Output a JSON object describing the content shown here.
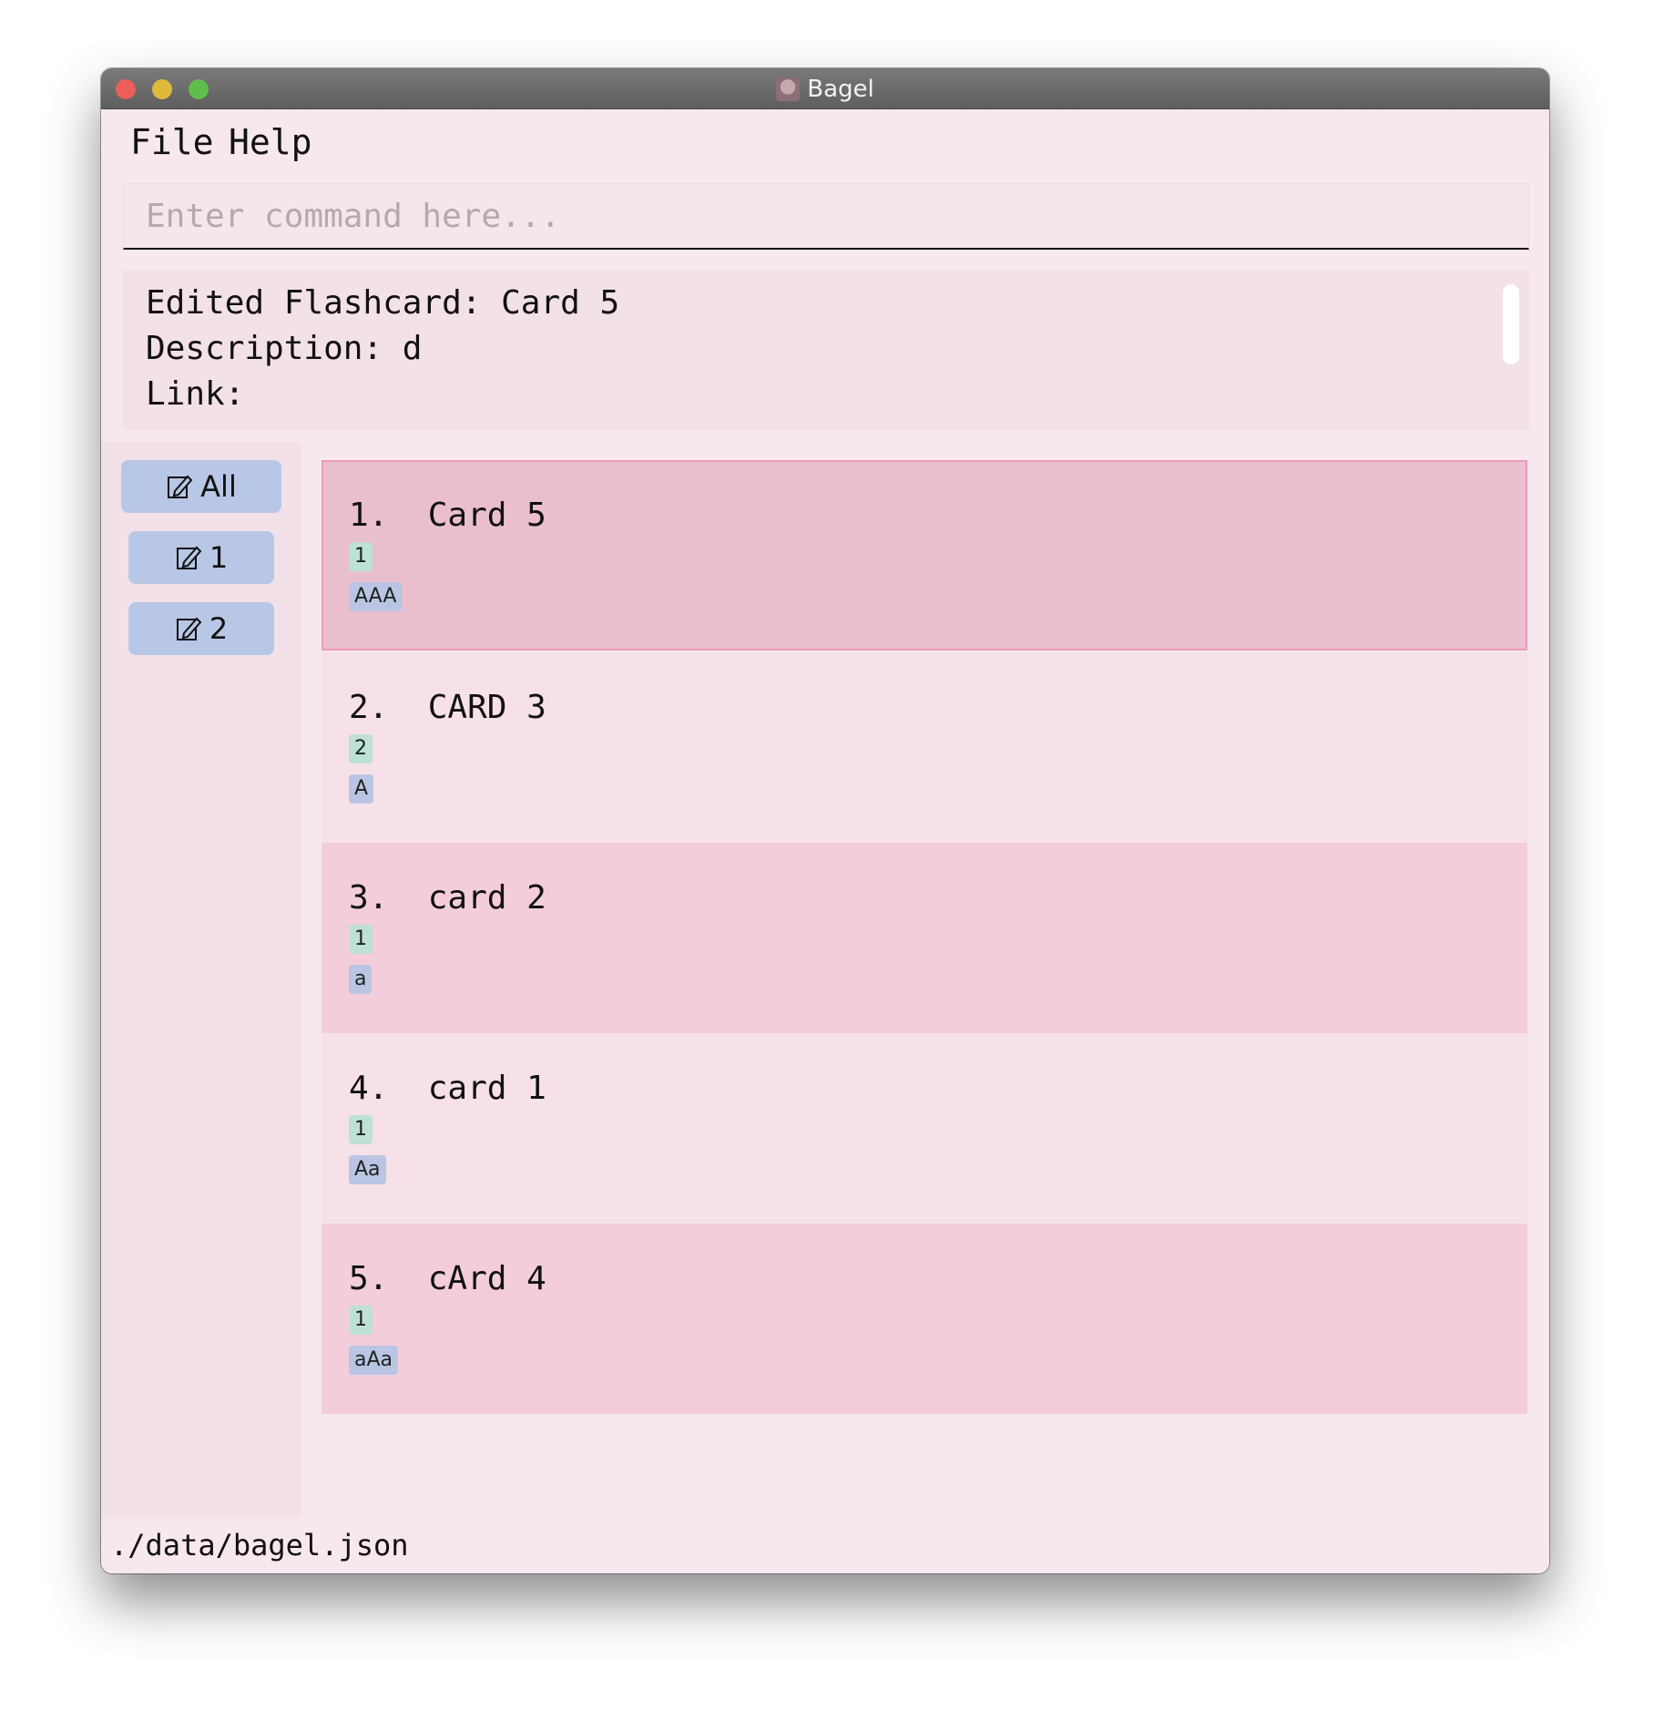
{
  "window": {
    "title": "Bagel"
  },
  "menu": {
    "items": [
      "File",
      "Help"
    ]
  },
  "command": {
    "placeholder": "Enter command here...",
    "value": ""
  },
  "result": {
    "lines": [
      "Edited Flashcard: Card 5",
      "Description: d",
      "Link:"
    ]
  },
  "sidebar": {
    "buttons": [
      {
        "label": "All",
        "icon": "edit-icon"
      },
      {
        "label": "1",
        "icon": "edit-icon"
      },
      {
        "label": "2",
        "icon": "edit-icon"
      }
    ]
  },
  "cards": [
    {
      "index": "1.",
      "title": "Card 5",
      "set": "1",
      "tag": "AAA",
      "selected": true
    },
    {
      "index": "2.",
      "title": "CARD 3",
      "set": "2",
      "tag": "A",
      "selected": false
    },
    {
      "index": "3.",
      "title": "card 2",
      "set": "1",
      "tag": "a",
      "selected": false
    },
    {
      "index": "4.",
      "title": "card 1",
      "set": "1",
      "tag": "Aa",
      "selected": false
    },
    {
      "index": "5.",
      "title": "cArd 4",
      "set": "1",
      "tag": "aAa",
      "selected": false
    }
  ],
  "status": {
    "path": "./data/bagel.json"
  },
  "colors": {
    "background": "#f6e8ee",
    "card_selected": "#e9bfce",
    "card_odd": "#f3cdda",
    "card_even": "#f6e1e8",
    "set_chip": "#bde1d2",
    "tag_chip": "#b9c5e2",
    "sidebar_button": "#b8c7e6"
  }
}
